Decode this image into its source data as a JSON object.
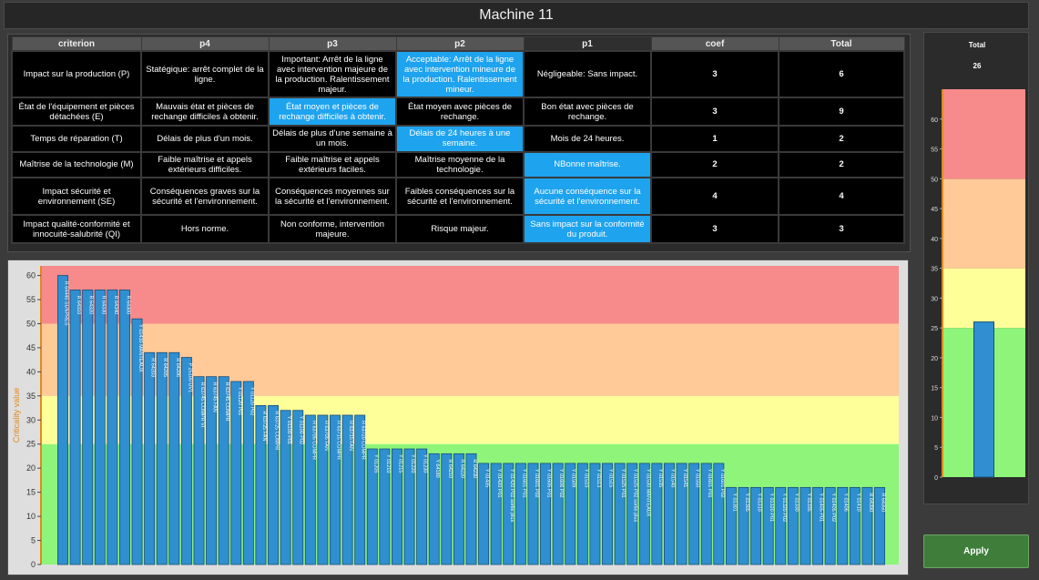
{
  "window": {
    "title": "Machine 11"
  },
  "criteria_table": {
    "headers": [
      "criterion",
      "p4",
      "p3",
      "p2",
      "p1",
      "coef",
      "Total"
    ],
    "rows": [
      {
        "criterion": "Impact sur la production (P)",
        "p4": "Statégique: arrêt complet de la ligne.",
        "p3": "Important: Arrêt de la ligne avec intervention majeure de la production. Ralentissement majeur.",
        "p2": "Acceptable: Arrêt de la ligne avec intervention mineure de la production. Ralentissement mineur.",
        "p1": "Négligeable: Sans impact.",
        "coef": "3",
        "total": "6",
        "selected": "p2"
      },
      {
        "criterion": "État de l'équipement et pièces détachées (E)",
        "p4": "Mauvais état et pièces de rechange difficiles à obtenir.",
        "p3": "État moyen et pièces de rechange difficiles à obtenir.",
        "p2": "État moyen avec pièces de rechange.",
        "p1": "Bon état avec pièces de rechange.",
        "coef": "3",
        "total": "9",
        "selected": "p3"
      },
      {
        "criterion": "Temps de réparation (T)",
        "p4": "Délais de plus d'un mois.",
        "p3": "Délais de plus d'une semaine à un mois.",
        "p2": "Délais de 24 heures à une semaine.",
        "p1": "Mois de 24 heures.",
        "coef": "1",
        "total": "2",
        "selected": "p2"
      },
      {
        "criterion": "Maîtrise de la technologie (M)",
        "p4": "Faible maîtrise et appels extérieurs difficiles.",
        "p3": "Faible maîtrise et appels extérieurs faciles.",
        "p2": "Maîtrise moyenne de la technologie.",
        "p1": "NBonne maîtrise.",
        "coef": "2",
        "total": "2",
        "selected": "p1"
      },
      {
        "criterion": "Impact sécurité et environnement (SE)",
        "p4": "Conséquences graves sur la sécurité et l'environnement.",
        "p3": "Conséquences moyennes sur la sécurité et l'environnement.",
        "p2": "Faibles conséquences sur la sécurité et l'environnement.",
        "p1": "Aucune conséquence sur la sécurité et l'environnement.",
        "coef": "4",
        "total": "4",
        "selected": "p1"
      },
      {
        "criterion": "Impact qualité-conformité et innocuité-salubrité (QI)",
        "p4": "Hors norme.",
        "p3": "Non conforme, intervention majeure.",
        "p2": "Risque majeur.",
        "p1": "Sans impact sur la conformité du produit.",
        "coef": "3",
        "total": "3",
        "selected": "p1"
      }
    ]
  },
  "colors": {
    "zone_red": "#f78a8a",
    "zone_orange": "#ffc998",
    "zone_yellow": "#ffff9a",
    "zone_green": "#8ef57a",
    "bar_fill": "#2f8fd0",
    "bar_stroke": "#1b4f78",
    "accent_orange": "#e08a1e",
    "apply_green": "#3f7e3a"
  },
  "chart_data": [
    {
      "type": "bar",
      "ylabel": "Criticality value",
      "ylim": [
        0,
        62
      ],
      "yticks": [
        0,
        5,
        10,
        15,
        20,
        25,
        30,
        35,
        40,
        45,
        50,
        55,
        60
      ],
      "zones": [
        {
          "from": 0,
          "to": 25,
          "color": "green"
        },
        {
          "from": 25,
          "to": 35,
          "color": "yellow"
        },
        {
          "from": 35,
          "to": 50,
          "color": "orange"
        },
        {
          "from": 50,
          "to": 62,
          "color": "red"
        }
      ],
      "categories": [
        "R 64440 SUNPRES",
        "R 64310",
        "R 64320",
        "R 64330",
        "R 64340",
        "R 64300",
        "Y 01430 MANTEAUX",
        "R 64203",
        "R 64205",
        "R 64206",
        "P 25100 UV1",
        "R 63745 COMPR VI",
        "R 63745 FAN",
        "R 63745 COMPR",
        "Y 01120 P01",
        "Y 01120 P02",
        "R 63725 FAN",
        "R 63725 COMPR",
        "Y 01100 P01",
        "Y 01100 P02",
        "R 63705 COMPR",
        "R 63705 FAN",
        "R 63715 COMPR",
        "R 63715 FAN",
        "R 63720 COMPR",
        "Y 01205",
        "Y 01210",
        "Y 01215",
        "Y 01220",
        "Y 01230",
        "Y 64180",
        "R 64210",
        "R 64220",
        "R 64230",
        "Y 01435",
        "Y 01420 P01",
        "Y 01420 P02 sortie plus",
        "Y 01601 P01",
        "Y 01601 P02",
        "Y 01606 P01",
        "Y 01606 P02",
        "Y 01509",
        "Y 01510",
        "Y 01513",
        "Y 01515",
        "Y 01525 P01",
        "Y 01525 P02 sortie plus",
        "Y 01530 MANTEAUX",
        "Y 01535",
        "Y 01540",
        "Y 01541",
        "Y 01550",
        "Y 01601 P01",
        "Y 01601 P02",
        "Y 01301",
        "Y 01305",
        "Y 01310",
        "Y 01320 P01",
        "Y 01320 P02",
        "Y 01330",
        "Y 01335",
        "Y 01405 P01",
        "Y 01405 P02",
        "Y 01406",
        "Y 01410",
        "R 64390",
        "R 64350"
      ],
      "values": [
        60,
        57,
        57,
        57,
        57,
        57,
        51,
        44,
        44,
        44,
        43,
        39,
        39,
        39,
        38,
        38,
        33,
        33,
        32,
        32,
        31,
        31,
        31,
        31,
        31,
        24,
        24,
        24,
        24,
        24,
        23,
        23,
        23,
        23,
        21,
        21,
        21,
        21,
        21,
        21,
        21,
        21,
        21,
        21,
        21,
        21,
        21,
        21,
        21,
        21,
        21,
        21,
        21,
        21,
        16,
        16,
        16,
        16,
        16,
        16,
        16,
        16,
        16,
        16,
        16,
        16,
        16
      ]
    },
    {
      "type": "bar",
      "title": "Total",
      "total_value": "26",
      "ylim": [
        0,
        65
      ],
      "yticks": [
        0,
        5,
        10,
        15,
        20,
        25,
        30,
        35,
        40,
        45,
        50,
        55,
        60
      ],
      "zones": [
        {
          "from": 0,
          "to": 25,
          "color": "green"
        },
        {
          "from": 25,
          "to": 35,
          "color": "yellow"
        },
        {
          "from": 35,
          "to": 50,
          "color": "orange"
        },
        {
          "from": 50,
          "to": 65,
          "color": "red"
        }
      ],
      "values": [
        26
      ]
    }
  ],
  "apply_button": {
    "label": "Apply"
  }
}
